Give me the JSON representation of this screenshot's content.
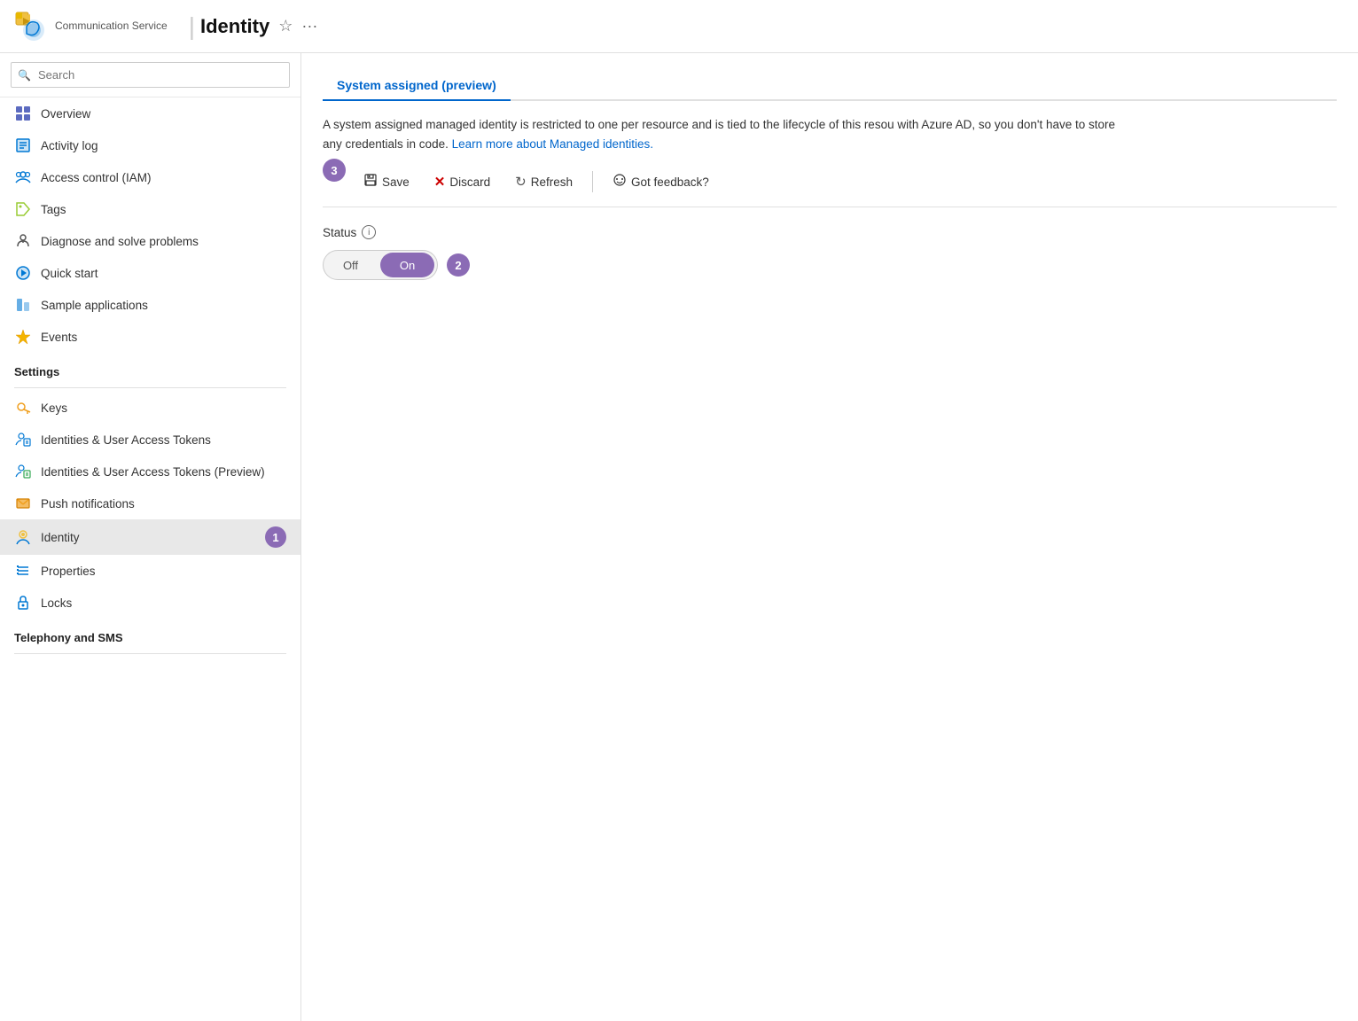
{
  "header": {
    "service_name": "Communication Service",
    "page_title": "Identity",
    "title_divider": "|",
    "star_icon": "☆",
    "more_icon": "···"
  },
  "sidebar": {
    "search_placeholder": "Search",
    "collapse_label": "«",
    "nav_items": [
      {
        "id": "overview",
        "label": "Overview",
        "icon": "overview"
      },
      {
        "id": "activity-log",
        "label": "Activity log",
        "icon": "activity"
      },
      {
        "id": "access-control",
        "label": "Access control (IAM)",
        "icon": "access"
      },
      {
        "id": "tags",
        "label": "Tags",
        "icon": "tags"
      },
      {
        "id": "diagnose",
        "label": "Diagnose and solve problems",
        "icon": "diagnose"
      },
      {
        "id": "quick-start",
        "label": "Quick start",
        "icon": "quickstart"
      },
      {
        "id": "sample-apps",
        "label": "Sample applications",
        "icon": "sample"
      },
      {
        "id": "events",
        "label": "Events",
        "icon": "events"
      }
    ],
    "settings_header": "Settings",
    "settings_items": [
      {
        "id": "keys",
        "label": "Keys",
        "icon": "keys"
      },
      {
        "id": "identities-tokens",
        "label": "Identities & User Access Tokens",
        "icon": "identities"
      },
      {
        "id": "identities-tokens-preview",
        "label": "Identities & User Access Tokens (Preview)",
        "icon": "identities-preview"
      },
      {
        "id": "push-notifications",
        "label": "Push notifications",
        "icon": "push"
      },
      {
        "id": "identity",
        "label": "Identity",
        "icon": "identity",
        "active": true,
        "badge": "1"
      },
      {
        "id": "properties",
        "label": "Properties",
        "icon": "properties"
      },
      {
        "id": "locks",
        "label": "Locks",
        "icon": "locks"
      }
    ],
    "telephony_header": "Telephony and SMS"
  },
  "content": {
    "tabs": [
      {
        "id": "system-assigned",
        "label": "System assigned (preview)",
        "active": true
      }
    ],
    "description": "A system assigned managed identity is restricted to one per resource and is tied to the lifecycle of this resou with Azure AD, so you don't have to store any credentials in code.",
    "learn_more_text": "Learn more about Managed identities.",
    "learn_more_url": "#",
    "toolbar": {
      "save_label": "Save",
      "discard_label": "Discard",
      "refresh_label": "Refresh",
      "feedback_label": "Got feedback?",
      "step_badge": "3"
    },
    "status": {
      "label": "Status",
      "toggle_off": "Off",
      "toggle_on": "On",
      "current": "on",
      "badge": "2"
    }
  }
}
